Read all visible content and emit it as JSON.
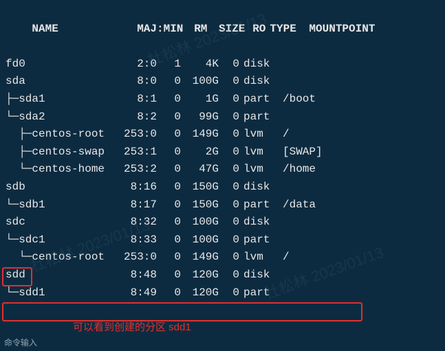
{
  "headers": {
    "name": "NAME",
    "majmin": "MAJ:MIN",
    "rm": "RM",
    "size": "SIZE",
    "ro": "RO",
    "type": "TYPE",
    "mnt": "MOUNTPOINT"
  },
  "rows": [
    {
      "name": "fd0",
      "majmin": "2:0",
      "rm": "1",
      "size": "4K",
      "ro": "0",
      "type": "disk",
      "mnt": ""
    },
    {
      "name": "sda",
      "majmin": "8:0",
      "rm": "0",
      "size": "100G",
      "ro": "0",
      "type": "disk",
      "mnt": ""
    },
    {
      "name": "├─sda1",
      "majmin": "8:1",
      "rm": "0",
      "size": "1G",
      "ro": "0",
      "type": "part",
      "mnt": "/boot"
    },
    {
      "name": "└─sda2",
      "majmin": "8:2",
      "rm": "0",
      "size": "99G",
      "ro": "0",
      "type": "part",
      "mnt": ""
    },
    {
      "name": "  ├─centos-root",
      "majmin": "253:0",
      "rm": "0",
      "size": "149G",
      "ro": "0",
      "type": "lvm",
      "mnt": "/"
    },
    {
      "name": "  ├─centos-swap",
      "majmin": "253:1",
      "rm": "0",
      "size": "2G",
      "ro": "0",
      "type": "lvm",
      "mnt": "[SWAP]"
    },
    {
      "name": "  └─centos-home",
      "majmin": "253:2",
      "rm": "0",
      "size": "47G",
      "ro": "0",
      "type": "lvm",
      "mnt": "/home"
    },
    {
      "name": "sdb",
      "majmin": "8:16",
      "rm": "0",
      "size": "150G",
      "ro": "0",
      "type": "disk",
      "mnt": ""
    },
    {
      "name": "└─sdb1",
      "majmin": "8:17",
      "rm": "0",
      "size": "150G",
      "ro": "0",
      "type": "part",
      "mnt": "/data"
    },
    {
      "name": "sdc",
      "majmin": "8:32",
      "rm": "0",
      "size": "100G",
      "ro": "0",
      "type": "disk",
      "mnt": ""
    },
    {
      "name": "└─sdc1",
      "majmin": "8:33",
      "rm": "0",
      "size": "100G",
      "ro": "0",
      "type": "part",
      "mnt": ""
    },
    {
      "name": "  └─centos-root",
      "majmin": "253:0",
      "rm": "0",
      "size": "149G",
      "ro": "0",
      "type": "lvm",
      "mnt": "/"
    },
    {
      "name": "sdd",
      "majmin": "8:48",
      "rm": "0",
      "size": "120G",
      "ro": "0",
      "type": "disk",
      "mnt": ""
    },
    {
      "name": "└─sdd1",
      "majmin": "8:49",
      "rm": "0",
      "size": "120G",
      "ro": "0",
      "type": "part",
      "mnt": ""
    }
  ],
  "annotation_text": "可以看到创建的分区 sdd1",
  "status_text": "命令输入",
  "watermark": "杜松林 2023/01/13"
}
